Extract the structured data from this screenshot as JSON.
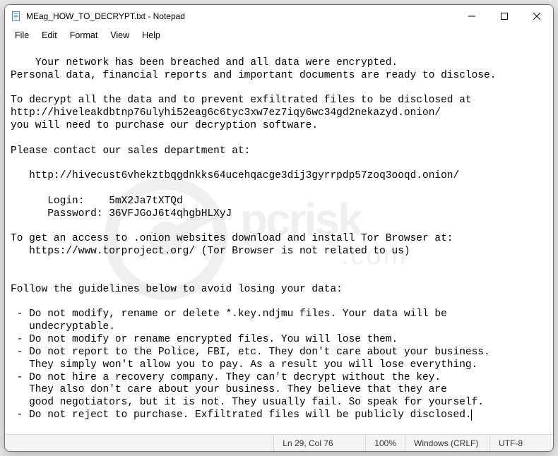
{
  "window": {
    "title": "MEag_HOW_TO_DECRYPT.txt - Notepad"
  },
  "menu": {
    "file": "File",
    "edit": "Edit",
    "format": "Format",
    "view": "View",
    "help": "Help"
  },
  "content": {
    "text": "Your network has been breached and all data were encrypted.\nPersonal data, financial reports and important documents are ready to disclose.\n\nTo decrypt all the data and to prevent exfiltrated files to be disclosed at\nhttp://hiveleakdbtnp76ulyhi52eag6c6tyc3xw7ez7iqy6wc34gd2nekazyd.onion/\nyou will need to purchase our decryption software.\n\nPlease contact our sales department at:\n\n   http://hivecust6vhekztbqgdnkks64ucehqacge3dij3gyrrpdp57zoq3ooqd.onion/\n\n      Login:    5mX2Ja7tXTQd\n      Password: 36VFJGoJ6t4qhgbHLXyJ\n\nTo get an access to .onion websites download and install Tor Browser at:\n   https://www.torproject.org/ (Tor Browser is not related to us)\n\n\nFollow the guidelines below to avoid losing your data:\n\n - Do not modify, rename or delete *.key.ndjmu files. Your data will be\n   undecryptable.\n - Do not modify or rename encrypted files. You will lose them.\n - Do not report to the Police, FBI, etc. They don't care about your business.\n   They simply won't allow you to pay. As a result you will lose everything.\n - Do not hire a recovery company. They can't decrypt without the key.\n   They also don't care about your business. They believe that they are\n   good negotiators, but it is not. They usually fail. So speak for yourself.\n - Do not reject to purchase. Exfiltrated files will be publicly disclosed."
  },
  "status": {
    "position": "Ln 29, Col 76",
    "zoom": "100%",
    "line_ending": "Windows (CRLF)",
    "encoding": "UTF-8"
  }
}
